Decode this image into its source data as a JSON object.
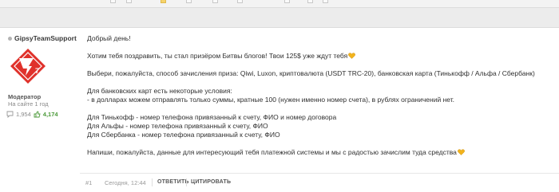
{
  "post": {
    "author": {
      "username": "GipsyTeamSupport",
      "role": "Модератор",
      "member_since": "На сайте 1 год",
      "messages_count": "1,954",
      "reputation": "4,174"
    },
    "message": {
      "greeting": "Добрый день!",
      "congrats": "Хотим тебя поздравить, ты стал призёром Битвы блогов! Твои 125$ уже ждут тебя",
      "choose_method": "Выбери, пожалуйста, способ зачисления приза:  Qiwi, Luxon, криптовалюта (USDT TRC-20), банковская карта (Тинькофф / Альфа / Сбербанк)",
      "bank_conditions_title": "Для банковских карт есть некоторые условия:",
      "bank_conditions_detail": "- в долларах можем отправлять только суммы, кратные 100 (нужен именно номер счета), в рублях ограничений нет.",
      "tinkoff": "Для Тинькофф - номер телефона привязанный к счету, ФИО и номер договора",
      "alfa": "Для Альфы - номер телефона привязанный к счету, ФИО",
      "sber": "Для Сбербанка - номер телефона привязанный к счету, ФИО",
      "closing": "Напиши, пожалуйста, данные для интересующий тебя платежной системы и мы с радостью зачислим туда средства"
    },
    "footer": {
      "post_number": "#1",
      "date": "Сегодня, 12:44",
      "reply_label": "ОТВЕТИТЬ",
      "quote_label": "ЦИТИРОВАТЬ"
    }
  },
  "colors": {
    "avatar_red": "#e0312b",
    "heart_gold": "#f2b31c",
    "reputation_green": "#4c9a3a"
  },
  "icons": {
    "online_status": "status-dot-icon",
    "messages": "speech-bubble-icon",
    "reputation": "thumbs-up-icon",
    "emoji": "yellow-heart-icon"
  }
}
